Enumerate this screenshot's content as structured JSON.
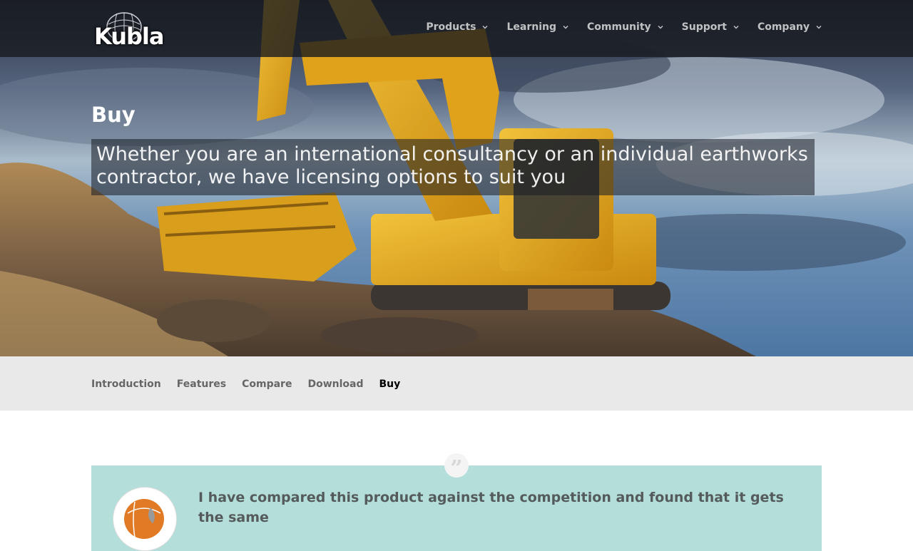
{
  "brand": {
    "logo_text": "Kubla"
  },
  "nav": {
    "items": [
      {
        "label": "Products"
      },
      {
        "label": "Learning"
      },
      {
        "label": "Community"
      },
      {
        "label": "Support"
      },
      {
        "label": "Company"
      }
    ]
  },
  "hero": {
    "title": "Buy",
    "subtitle": "Whether you are an international consultancy or an individual earthworks contractor, we have licensing options to suit you"
  },
  "subnav": {
    "items": [
      {
        "label": "Introduction"
      },
      {
        "label": "Features"
      },
      {
        "label": "Compare"
      },
      {
        "label": "Download"
      },
      {
        "label": "Buy",
        "active": true
      }
    ]
  },
  "testimonial": {
    "quote_mark": "”",
    "text": "I have compared this product against the competition and found that it gets the same"
  },
  "colors": {
    "topbar": "#16181e",
    "subnav_bg": "#e9e9e9",
    "testimonial_bg": "#b4ded9",
    "excavator": "#e7a91a"
  }
}
